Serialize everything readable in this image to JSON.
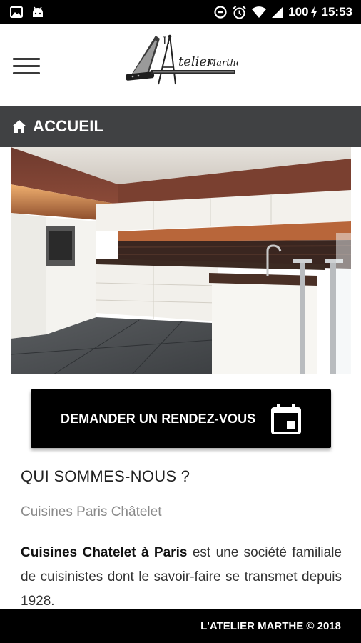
{
  "status_bar": {
    "battery": "100",
    "time": "15:53",
    "icons": [
      "image-icon",
      "android-icon",
      "data-saver-icon",
      "alarm-icon",
      "wifi-icon",
      "signal-icon",
      "battery-charging-icon"
    ]
  },
  "header": {
    "logo_text": "L'Atelier Marthe",
    "menu_icon": "hamburger-menu-icon"
  },
  "nav": {
    "icon": "home-icon",
    "title": "ACCUEIL"
  },
  "hero": {
    "image": "kitchen-photo"
  },
  "cta": {
    "label": "DEMANDER UN RENDEZ-VOUS",
    "icon": "calendar-icon"
  },
  "about": {
    "title": "QUI SOMMES-NOUS ?",
    "subtitle": "Cuisines Paris Châtelet",
    "paragraph_bold": "Cuisines Chatelet à Paris",
    "paragraph_rest": " est une société familiale de cuisinistes dont le savoir-faire se transmet depuis 1928."
  },
  "footer": {
    "text": "L'ATELIER MARTHE © 2018"
  },
  "colors": {
    "nav_bar": "#404143",
    "cta_background": "#000000",
    "footer_background": "#000000"
  }
}
